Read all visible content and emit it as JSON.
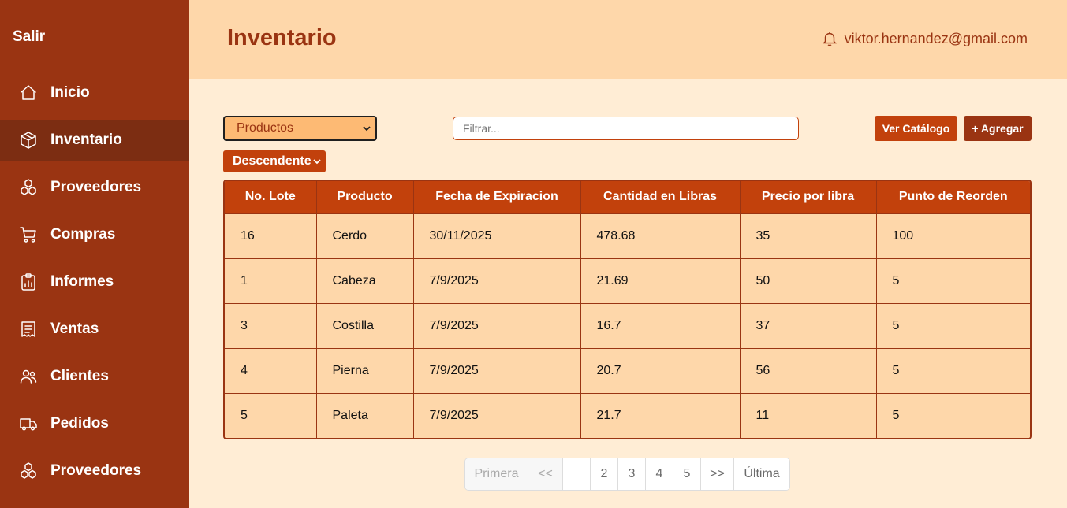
{
  "sidebar": {
    "logout_label": "Salir",
    "items": [
      {
        "label": "Inicio",
        "icon": "home-icon",
        "active": false
      },
      {
        "label": "Inventario",
        "icon": "box-icon",
        "active": true
      },
      {
        "label": "Proveedores",
        "icon": "cubes-icon",
        "active": false
      },
      {
        "label": "Compras",
        "icon": "cart-icon",
        "active": false
      },
      {
        "label": "Informes",
        "icon": "report-icon",
        "active": false
      },
      {
        "label": "Ventas",
        "icon": "receipt-icon",
        "active": false
      },
      {
        "label": "Clientes",
        "icon": "users-icon",
        "active": false
      },
      {
        "label": "Pedidos",
        "icon": "truck-icon",
        "active": false
      },
      {
        "label": "Proveedores",
        "icon": "cubes-icon",
        "active": false
      }
    ]
  },
  "header": {
    "title": "Inventario",
    "user_email": "viktor.hernandez@gmail.com"
  },
  "toolbar": {
    "category_select": "Productos",
    "filter_placeholder": "Filtrar...",
    "catalog_button": "Ver Catálogo",
    "add_button": "+ Agregar",
    "order_select": "Descendente"
  },
  "table": {
    "columns": [
      "No. Lote",
      "Producto",
      "Fecha de Expiracion",
      "Cantidad en Libras",
      "Precio por libra",
      "Punto de Reorden"
    ],
    "rows": [
      [
        "16",
        "Cerdo",
        "30/11/2025",
        "478.68",
        "35",
        "100"
      ],
      [
        "1",
        "Cabeza",
        "7/9/2025",
        "21.69",
        "50",
        "5"
      ],
      [
        "3",
        "Costilla",
        "7/9/2025",
        "16.7",
        "37",
        "5"
      ],
      [
        "4",
        "Pierna",
        "7/9/2025",
        "20.7",
        "56",
        "5"
      ],
      [
        "5",
        "Paleta",
        "7/9/2025",
        "21.7",
        "11",
        "5"
      ]
    ]
  },
  "pagination": {
    "first": "Primera",
    "prev": "<<",
    "pages": [
      "",
      "2",
      "3",
      "4",
      "5"
    ],
    "next": ">>",
    "last": "Última"
  },
  "colors": {
    "sidebar": "#9A3412",
    "sidebar_active": "#7C2D12",
    "header": "#FED7AA",
    "background": "#FFEDD5",
    "accent": "#C2410C"
  }
}
